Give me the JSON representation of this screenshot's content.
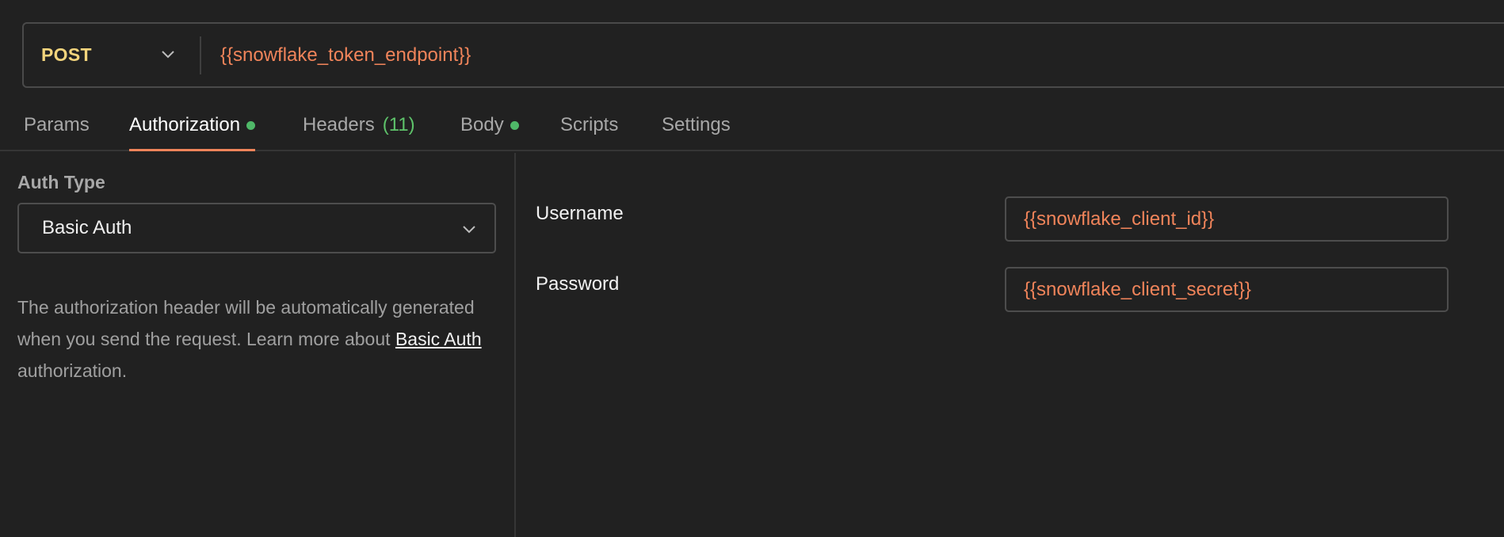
{
  "request": {
    "method": "POST",
    "url": "{{snowflake_token_endpoint}}"
  },
  "tabs": [
    {
      "label": "Params"
    },
    {
      "label": "Authorization",
      "active": true,
      "has_dot": true
    },
    {
      "label": "Headers",
      "count": "(11)"
    },
    {
      "label": "Body",
      "has_dot": true
    },
    {
      "label": "Scripts"
    },
    {
      "label": "Settings"
    }
  ],
  "auth": {
    "type_label": "Auth Type",
    "selected_type": "Basic Auth",
    "description_pre": "The authorization header will be automatically generated when you send the request. Learn more about ",
    "description_link": "Basic Auth",
    "description_post": " authorization."
  },
  "fields": {
    "username_label": "Username",
    "username_value": "{{snowflake_client_id}}",
    "password_label": "Password",
    "password_value": "{{snowflake_client_secret}}"
  },
  "colors": {
    "accent": "#f0845a",
    "method": "#f2d47c",
    "status_dot": "#4fb868",
    "count": "#5ec26a",
    "background": "#212121"
  },
  "icons": {
    "method_dropdown": "chevron-down-icon",
    "auth_dropdown": "chevron-down-icon",
    "tab_indicator": "dot-icon"
  }
}
